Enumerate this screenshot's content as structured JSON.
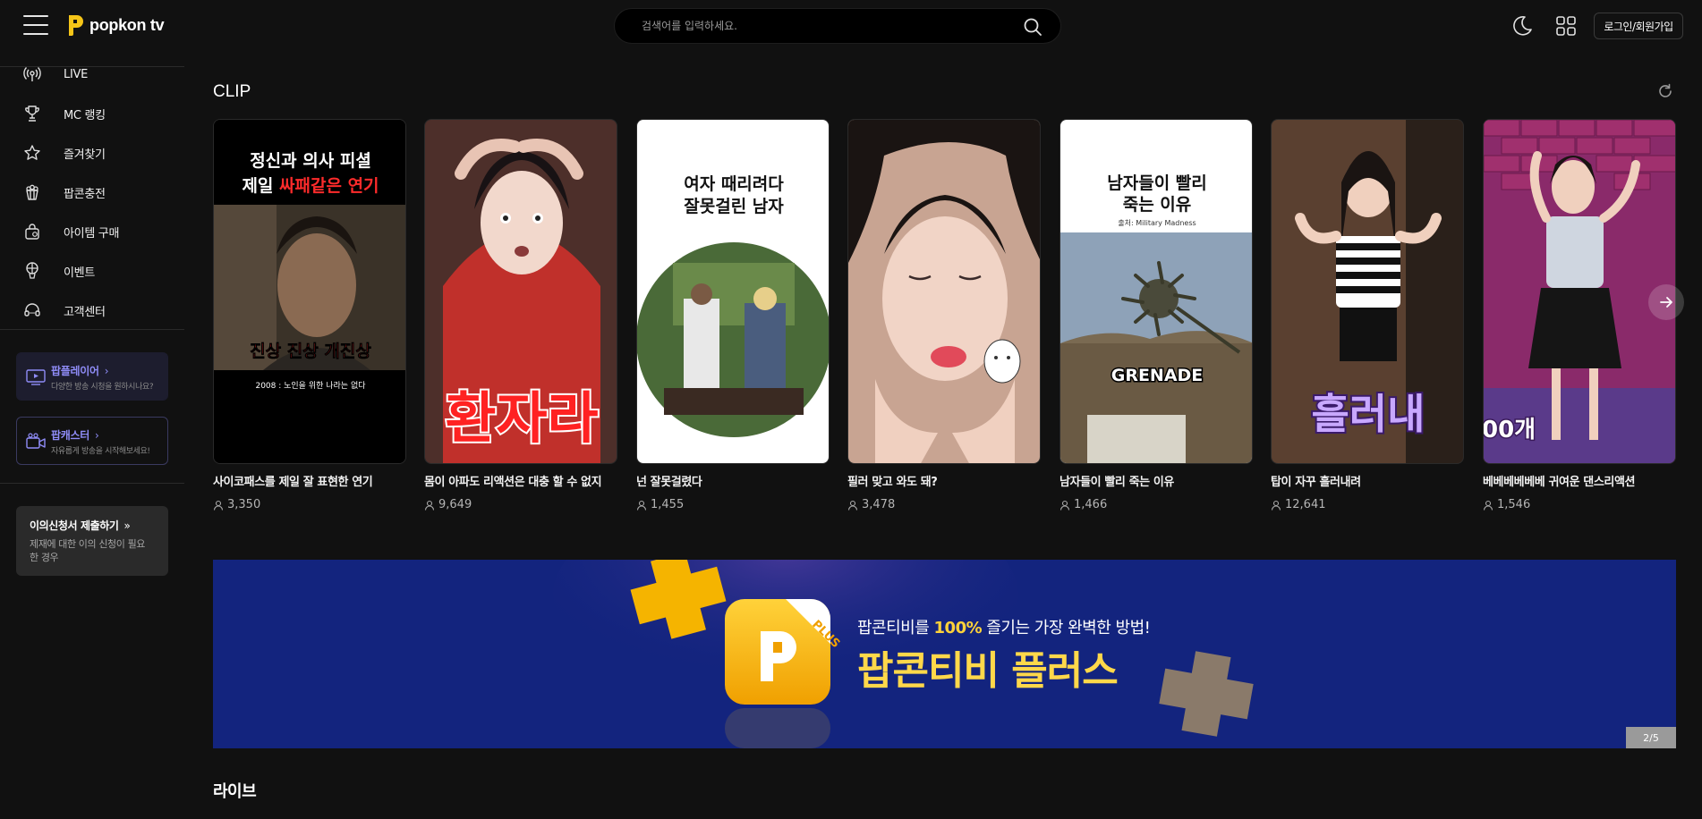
{
  "header": {
    "logo_text": "popkon tv",
    "search_placeholder": "검색어를 입력하세요.",
    "login_label": "로그인/회원가입",
    "brand_color": "#f5c518"
  },
  "sidebar": {
    "items": [
      {
        "label": "LIVE",
        "icon": "live-broadcast-icon"
      },
      {
        "label": "MC 랭킹",
        "icon": "trophy-icon"
      },
      {
        "label": "즐겨찾기",
        "icon": "star-icon"
      },
      {
        "label": "팝콘충전",
        "icon": "popcorn-icon"
      },
      {
        "label": "아이템 구매",
        "icon": "shopping-bag-icon"
      },
      {
        "label": "이벤트",
        "icon": "balloon-icon"
      },
      {
        "label": "고객센터",
        "icon": "headset-icon"
      }
    ],
    "popplayer": {
      "title": "팝플레이어",
      "sub": "다양한 방송 시청을 원하시나요?"
    },
    "popcaster": {
      "title": "팝캐스터",
      "sub": "자유롭게 방송을 시작해보세요!"
    },
    "appeal": {
      "title": "이의신청서 제출하기",
      "sub": "제재에 대한 이의 신청이 필요한 경우"
    }
  },
  "clip": {
    "section_title": "CLIP",
    "cards": [
      {
        "title": "사이코패스를 제일 잘 표현한 연기",
        "views": "3,350",
        "thumb": {
          "line1": "정신과 의사 피셜",
          "line2a": "제일 ",
          "line2b": "싸패같은 연기",
          "caption": "진상 진상 개진상",
          "footer": "2008 : 노인을 위한 나라는 없다"
        }
      },
      {
        "title": "몸이 아파도 리액션은 대충 할 수 없지",
        "views": "9,649",
        "thumb": {
          "caption": "환자라"
        }
      },
      {
        "title": "넌 잘못걸렸다",
        "views": "1,455",
        "thumb": {
          "line1": "여자 때리려다",
          "line2": "잘못걸린 남자"
        }
      },
      {
        "title": "필러 맞고 와도 돼?",
        "views": "3,478",
        "thumb": {}
      },
      {
        "title": "남자들이 빨리 죽는 이유",
        "views": "1,466",
        "thumb": {
          "line1": "남자들이 빨리",
          "line2": "죽는 이유",
          "source": "출처: Military Madness",
          "caption": "GRENADE"
        }
      },
      {
        "title": "탑이 자꾸 흘러내려",
        "views": "12,641",
        "thumb": {
          "caption": "흘러내"
        }
      },
      {
        "title": "베베베베베베 귀여운 댄스리액션",
        "views": "1,546",
        "thumb": {
          "caption": "00개"
        }
      }
    ]
  },
  "banner": {
    "line1_prefix": "팝콘티비를 ",
    "line1_highlight": "100%",
    "line1_suffix": " 즐기는 가장 완벽한 방법!",
    "line2": "팝콘티비 플러스",
    "badge": "PLUS",
    "pager": "2/5"
  },
  "live": {
    "section_title": "라이브"
  }
}
